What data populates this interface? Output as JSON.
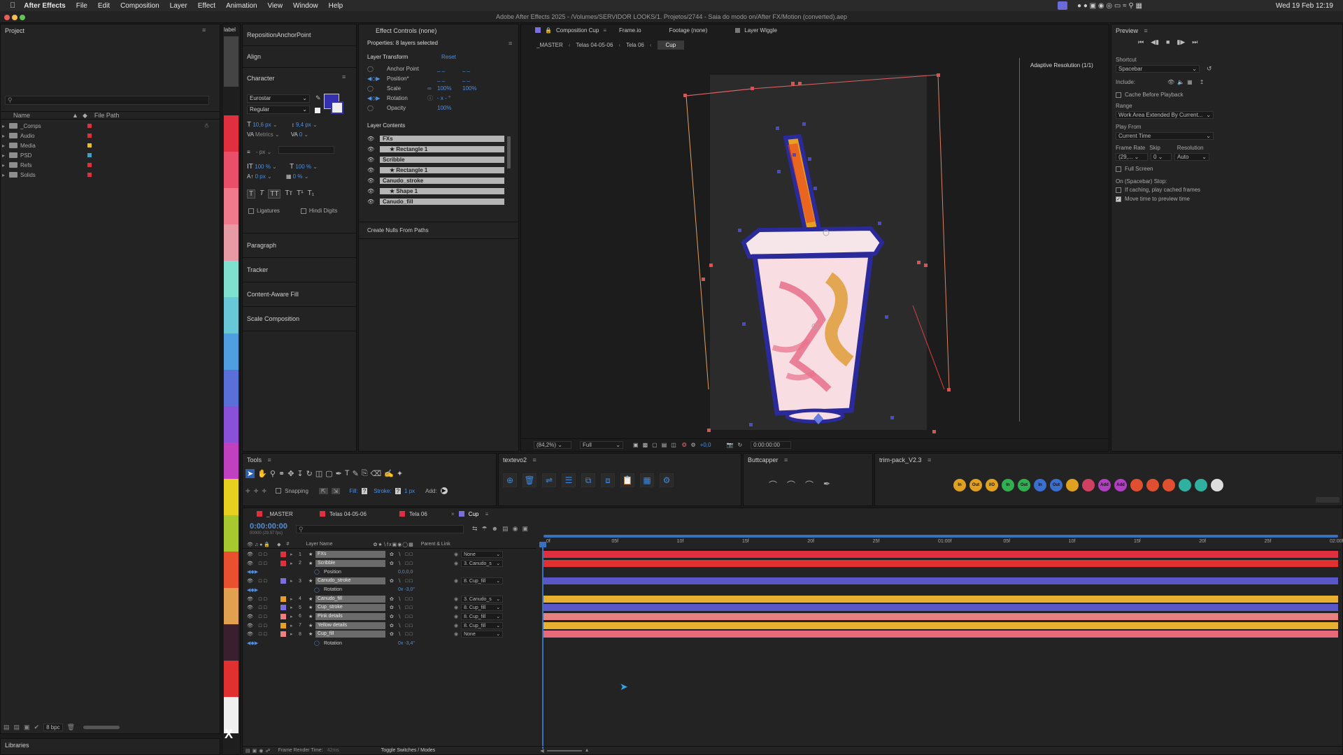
{
  "menubar": {
    "app_name": "After Effects",
    "items": [
      "File",
      "Edit",
      "Composition",
      "Layer",
      "Effect",
      "Animation",
      "View",
      "Window",
      "Help"
    ],
    "clock": "Wed 19 Feb  12:19"
  },
  "window_title": "Adobe After Effects 2025 - /Volumes/SERVIDOR LOOKS/1. Projetos/2744 - Saia do modo on/After FX/Motion (converted).aep",
  "project": {
    "title": "Project",
    "col_name": "Name",
    "col_path": "File Path",
    "items": [
      {
        "label": "_Comps",
        "color": "#e0303f"
      },
      {
        "label": "Audio",
        "color": "#e0303f"
      },
      {
        "label": "Media",
        "color": "#e8c020"
      },
      {
        "label": "PSD",
        "color": "#3aa0c8"
      },
      {
        "label": "Refs",
        "color": "#e0303f"
      },
      {
        "label": "Solids",
        "color": "#e0303f"
      }
    ],
    "bpc": "8 bpc",
    "libraries": "Libraries"
  },
  "label_panel": {
    "title": "label"
  },
  "side_panels": {
    "items": [
      "RepositionAnchorPoint",
      "Align"
    ],
    "character_title": "Character",
    "font": "Eurostar",
    "style": "Regular",
    "size": "10,6 px",
    "leading": "9,4 px",
    "kerning": "Metrics",
    "tracking": "0",
    "stroke_px": "- px",
    "vscale": "100 %",
    "hscale": "100 %",
    "baseline": "0 px",
    "tsume": "0 %",
    "ligatures": "Ligatures",
    "hindi": "Hindi Digits",
    "lower": [
      "Paragraph",
      "Tracker",
      "Content-Aware Fill",
      "Scale Composition"
    ]
  },
  "effect_controls": {
    "tab": "Effect Controls (none)",
    "properties": "Properties: 8 layers selected",
    "layer_transform": "Layer Transform",
    "reset": "Reset",
    "props": [
      {
        "name": "Anchor Point",
        "v1": "",
        "v2": ""
      },
      {
        "name": "Position*",
        "v1": "",
        "v2": ""
      },
      {
        "name": "Scale",
        "v1": "100%",
        "v2": "100%"
      },
      {
        "name": "Rotation",
        "v1": "- x - °",
        "v2": ""
      },
      {
        "name": "Opacity",
        "v1": "100%",
        "v2": ""
      }
    ],
    "layer_contents": "Layer Contents",
    "contents": [
      {
        "label": "FXs",
        "star": false
      },
      {
        "label": "Rectangle 1",
        "star": true
      },
      {
        "label": "Scribble",
        "star": false
      },
      {
        "label": "Rectangle 1",
        "star": true
      },
      {
        "label": "Canudo_stroke",
        "star": false
      },
      {
        "label": "Shape 1",
        "star": true
      },
      {
        "label": "Canudo_fill",
        "star": false
      }
    ],
    "create_nulls": "Create Nulls From Paths"
  },
  "composition": {
    "tabs": [
      "Composition Cup",
      "Frame.io",
      "Footage (none)",
      "Layer Wiggle"
    ],
    "breadcrumbs": [
      "_MASTER",
      "Telas 04-05-06",
      "Tela 06",
      "Cup"
    ],
    "adaptive": "Adaptive Resolution (1/1)",
    "zoom": "(84,2%)",
    "quality": "Full",
    "exposure": "+0,0",
    "timecode": "0:00:00:00"
  },
  "preview": {
    "title": "Preview",
    "shortcut_label": "Shortcut",
    "shortcut": "Spacebar",
    "include": "Include:",
    "cache_before": "Cache Before Playback",
    "range_label": "Range",
    "range": "Work Area Extended By Current...",
    "play_from_label": "Play From",
    "play_from": "Current Time",
    "frame_rate_label": "Frame Rate",
    "skip_label": "Skip",
    "resolution_label": "Resolution",
    "frame_rate": "(29,...",
    "skip": "0",
    "resolution": "Auto",
    "full_screen": "Full Screen",
    "on_stop": "On (Spacebar) Stop:",
    "if_caching": "If caching, play cached frames",
    "move_time": "Move time to preview time"
  },
  "tools": {
    "title": "Tools",
    "snapping": "Snapping",
    "fill": "Fill:",
    "stroke": "Stroke:",
    "stroke_px": "1 px",
    "add": "Add:"
  },
  "textevo": {
    "title": "textevo2"
  },
  "buttcapper": {
    "title": "Buttcapper"
  },
  "trimpack": {
    "title": "trim-pack_V2.3",
    "buttons": [
      {
        "t": "In",
        "c": "#e0a020"
      },
      {
        "t": "Out",
        "c": "#e0a020"
      },
      {
        "t": "I/O",
        "c": "#e0a020"
      },
      {
        "t": "In",
        "c": "#30b050"
      },
      {
        "t": "Out",
        "c": "#30b050"
      },
      {
        "t": "In",
        "c": "#3a6fd0"
      },
      {
        "t": "Out",
        "c": "#3a6fd0"
      },
      {
        "t": "",
        "c": "#e0a020"
      },
      {
        "t": "",
        "c": "#d04060"
      },
      {
        "t": "Add",
        "c": "#b040c0"
      },
      {
        "t": "Add",
        "c": "#b040c0"
      },
      {
        "t": "",
        "c": "#e05030"
      },
      {
        "t": "",
        "c": "#e05030"
      },
      {
        "t": "",
        "c": "#e05030"
      },
      {
        "t": "",
        "c": "#30b0a0"
      },
      {
        "t": "",
        "c": "#30b0a0"
      },
      {
        "t": "",
        "c": "#dddddd"
      }
    ]
  },
  "timeline": {
    "tabs": [
      {
        "label": "_MASTER",
        "color": "#e0303f"
      },
      {
        "label": "Telas 04-05-06",
        "color": "#e0303f"
      },
      {
        "label": "Tela 06",
        "color": "#e0303f"
      },
      {
        "label": "Cup",
        "color": "#7a6fe0"
      }
    ],
    "timecode": "0:00:00:00",
    "fps": "00000 (29.97 fps)",
    "col_layer": "Layer Name",
    "col_parent": "Parent & Link",
    "ruler": [
      "0f",
      "05f",
      "10f",
      "15f",
      "20f",
      "25f",
      "01:00f",
      "05f",
      "10f",
      "15f",
      "20f",
      "25f",
      "02:00f"
    ],
    "layers": [
      {
        "num": "1",
        "name": "FXs",
        "label": "#e0303f",
        "parent": "None",
        "bar": "#e0303f"
      },
      {
        "num": "2",
        "name": "Scribble",
        "label": "#e0303f",
        "parent": "3. Canudo_s",
        "bar": "#e03030"
      },
      {
        "prop": "Position",
        "value": "0,0,0,0"
      },
      {
        "num": "3",
        "name": "Canudo_stroke",
        "label": "#7a6fe0",
        "parent": "8. Cup_fill",
        "bar": "#5a58c8"
      },
      {
        "prop": "Rotation",
        "value": "0x -3,0°"
      },
      {
        "num": "4",
        "name": "Canudo_fill",
        "label": "#e8a020",
        "parent": "3. Canudo_s",
        "bar": "#e8b030"
      },
      {
        "num": "5",
        "name": "Cup_stroke",
        "label": "#7a6fe0",
        "parent": "8. Cup_fill",
        "bar": "#5a58c8"
      },
      {
        "num": "6",
        "name": "Pink details",
        "label": "#f08080",
        "parent": "8. Cup_fill",
        "bar": "#e88080"
      },
      {
        "num": "7",
        "name": "Yellow details",
        "label": "#e8a020",
        "parent": "8. Cup_fill",
        "bar": "#e8b030"
      },
      {
        "num": "8",
        "name": "Cup_fill",
        "label": "#f08080",
        "parent": "None",
        "bar": "#e86a7a"
      },
      {
        "prop": "Rotation",
        "value": "0x -3,4°"
      }
    ],
    "footer_render": "Frame Render Time:",
    "footer_ms": "42ms",
    "toggle": "Toggle Switches / Modes"
  },
  "label_colors": [
    "#e0303f",
    "#ea4f6a",
    "#f07a8c",
    "#e89aa4",
    "#7fe0d0",
    "#68c8d8",
    "#4f9ee0",
    "#5a70d8",
    "#8a50d8",
    "#c040c0",
    "#e8d020",
    "#a8c830",
    "#e85030",
    "#e0a050",
    "#3a1f2f",
    "#e03030",
    "#f0f0f0"
  ]
}
